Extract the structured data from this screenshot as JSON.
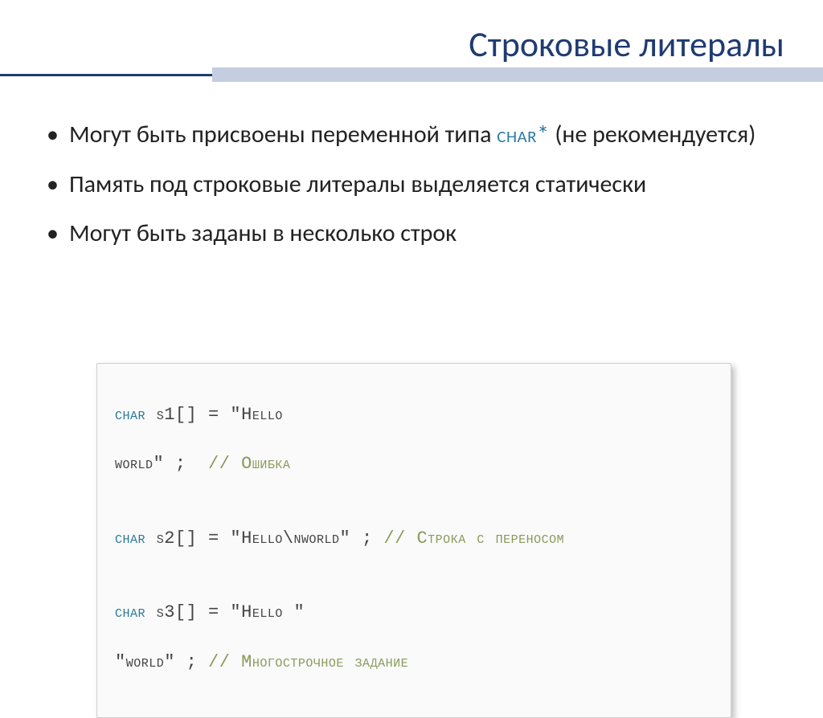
{
  "title": "Строковые литералы",
  "bullets": [
    {
      "pre": "Могут быть присвоены переменной типа ",
      "kw": "char*",
      "post": "  (не рекомендуется)"
    },
    {
      "pre": "Память под строковые литералы выделяется статически",
      "kw": "",
      "post": ""
    },
    {
      "pre": "Могут быть заданы в несколько строк",
      "kw": "",
      "post": ""
    }
  ],
  "code": {
    "l1_kw": "char",
    "l1_rest": " s1[] = \"Hello",
    "l2_rest": "world\" ;  ",
    "l2_cm": "// Ошибка",
    "l3_kw": "char",
    "l3_rest": " s2[] = \"Hello\\nworld\" ; ",
    "l3_cm": "// Строка с переносом",
    "l4_kw": "char",
    "l4_rest": " s3[] = \"Hello \"",
    "l5_rest": "\"world\" ; ",
    "l5_cm": "// Многострочное задание"
  }
}
